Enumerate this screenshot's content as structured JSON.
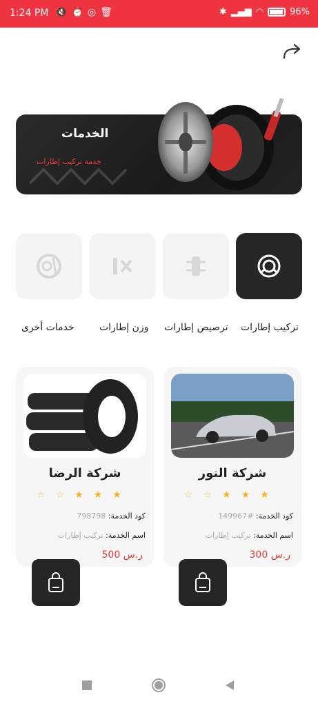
{
  "status": {
    "time": "1:24 PM",
    "battery": "96%"
  },
  "banner": {
    "title": "الخدمات",
    "subtitle": "خدمة تركيب إطارات"
  },
  "categories": [
    {
      "label": "تركيب إطارات",
      "icon": "tire-service-icon",
      "active": true
    },
    {
      "label": "ترصيص إطارات",
      "icon": "tire-balancing-icon",
      "active": false
    },
    {
      "label": "وزن إطارات",
      "icon": "wheel-alignment-icon",
      "active": false
    },
    {
      "label": "خدمات أخرى",
      "icon": "tire-other-icon",
      "active": false
    }
  ],
  "cards": [
    {
      "name": "شركة النور",
      "code_label": "كود الخدمة:",
      "code": "#149967",
      "service_label": "اسم الخدمة:",
      "service": "تركيب إطارات",
      "price": "300 ر.س",
      "rating": 3,
      "image": "car-photo"
    },
    {
      "name": "شركة الرضا",
      "code_label": "كود الخدمة:",
      "code": "798798",
      "service_label": "اسم الخدمة:",
      "service": "تركيب إطارات",
      "price": "500 ر.س",
      "rating": 3,
      "image": "tires-photo"
    }
  ],
  "colors": {
    "accent": "#ef3340",
    "dark": "#262626",
    "star": "#f6b21a",
    "price": "#e53935"
  }
}
